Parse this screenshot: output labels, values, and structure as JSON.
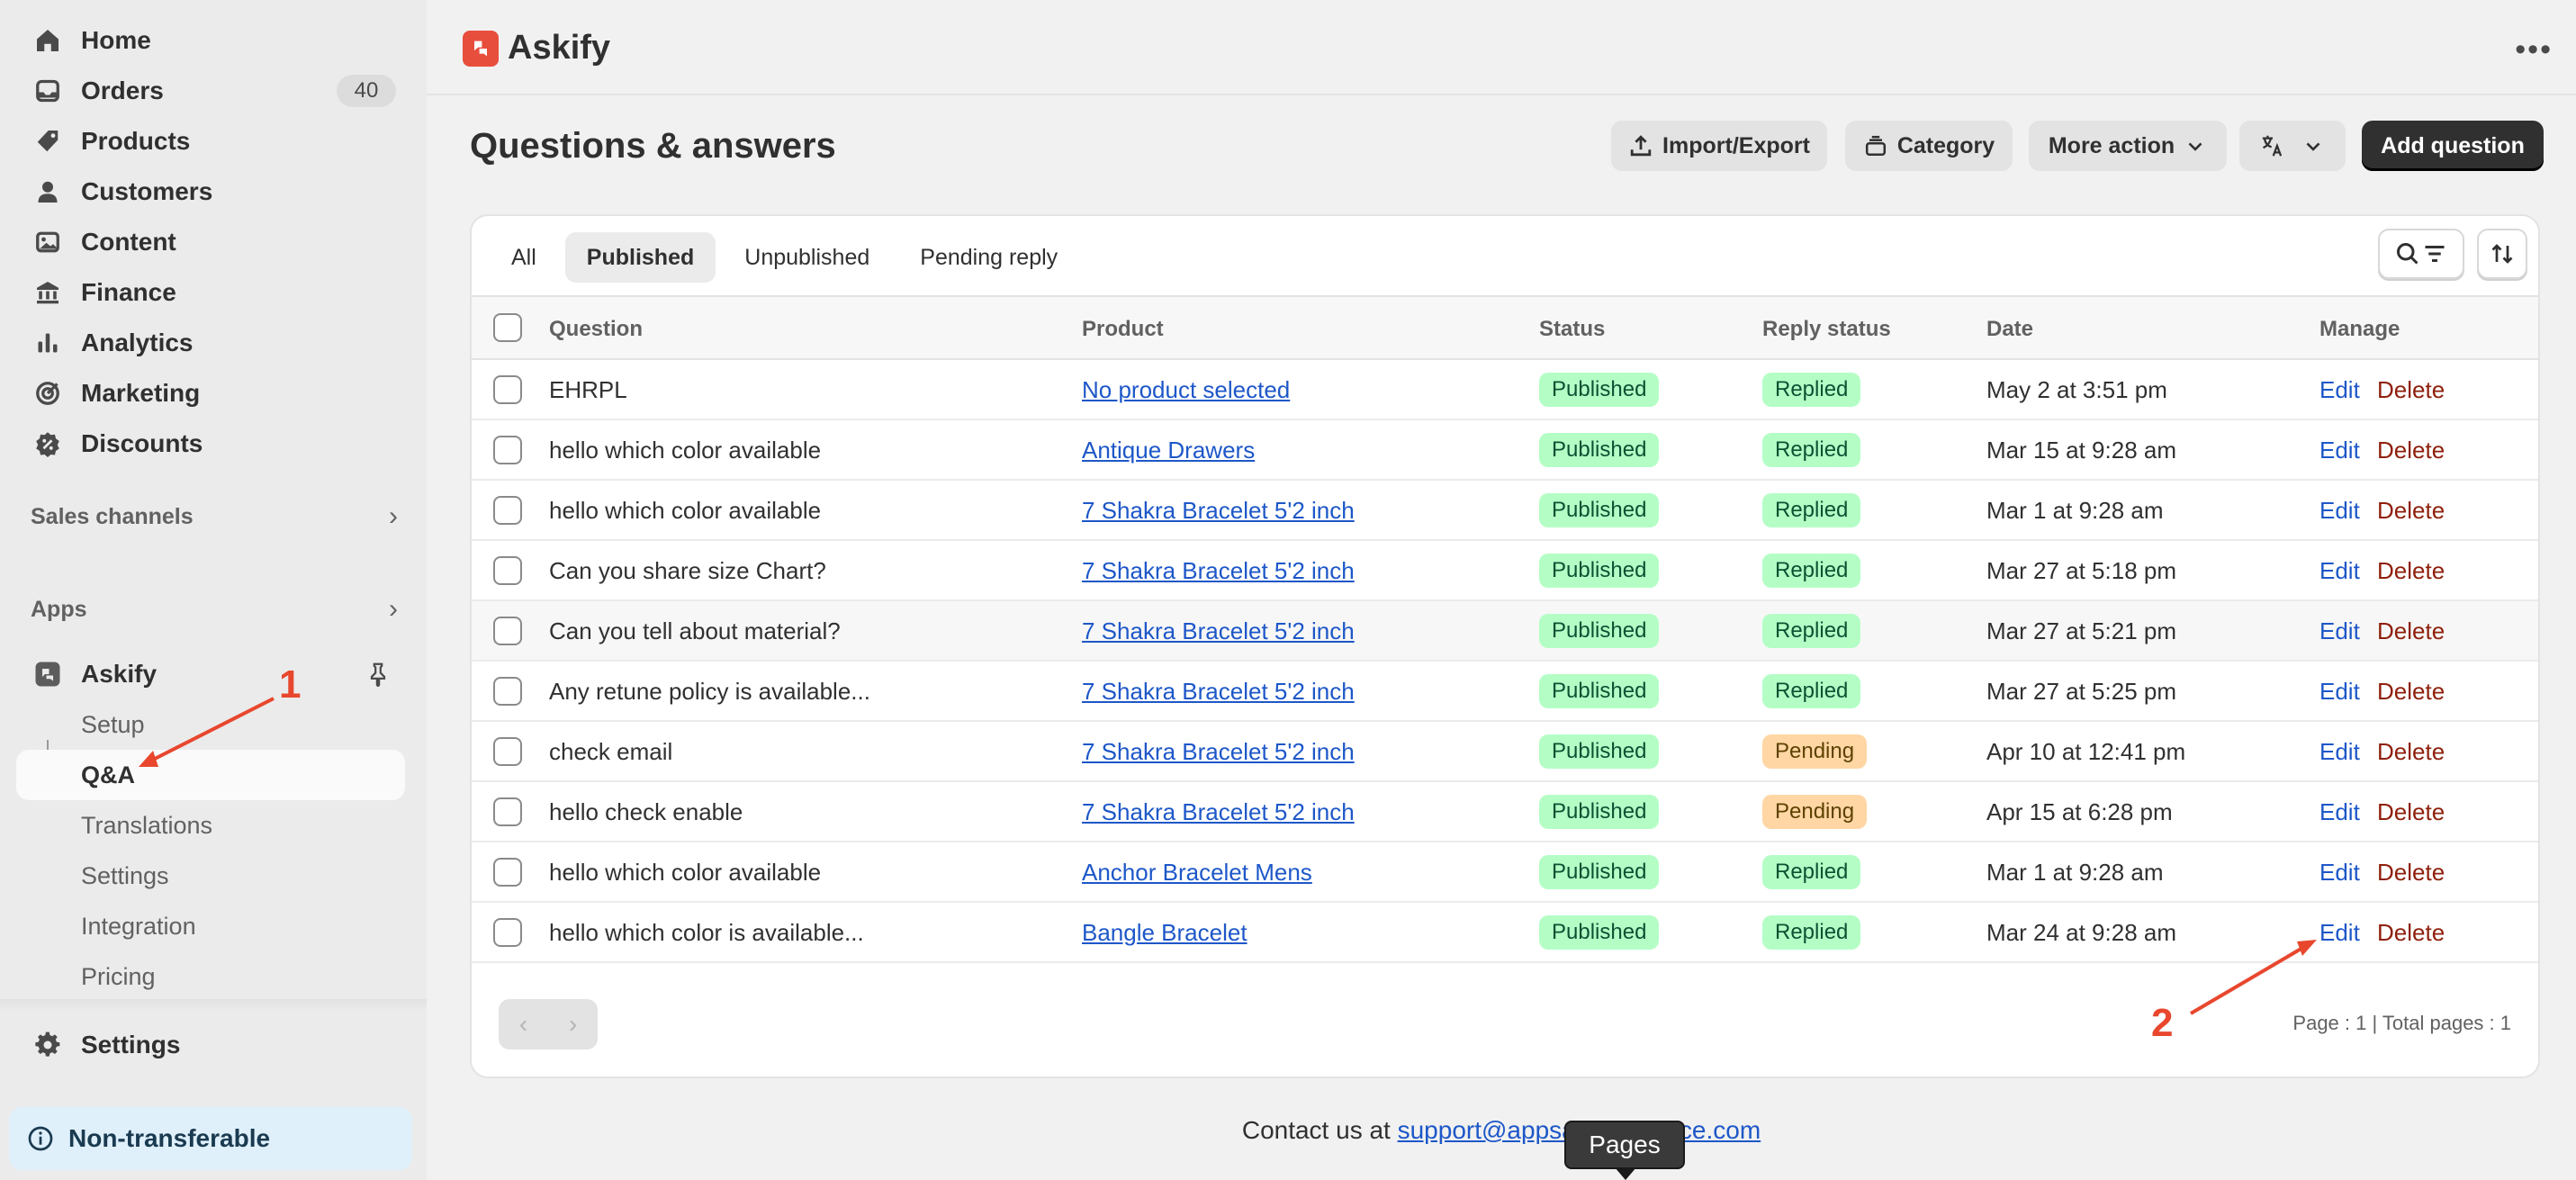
{
  "sidebar": {
    "items": [
      {
        "label": "Home",
        "icon": "home-icon"
      },
      {
        "label": "Orders",
        "icon": "inbox-icon",
        "badge": "40"
      },
      {
        "label": "Products",
        "icon": "tag-icon"
      },
      {
        "label": "Customers",
        "icon": "person-icon"
      },
      {
        "label": "Content",
        "icon": "image-icon"
      },
      {
        "label": "Finance",
        "icon": "bank-icon"
      },
      {
        "label": "Analytics",
        "icon": "bar-chart-icon"
      },
      {
        "label": "Marketing",
        "icon": "target-icon"
      },
      {
        "label": "Discounts",
        "icon": "discount-icon"
      }
    ],
    "sales_channels": "Sales channels",
    "apps": "Apps",
    "app": {
      "label": "Askify",
      "icon": "askify-logo-icon"
    },
    "app_sub": [
      "Setup",
      "Q&A",
      "Translations",
      "Settings",
      "Integration",
      "Pricing"
    ],
    "settings": "Settings",
    "banner": "Non-transferable"
  },
  "header": {
    "app_name": "Askify"
  },
  "page": {
    "title": "Questions & answers",
    "actions": {
      "import_export": "Import/Export",
      "category": "Category",
      "more_action": "More action",
      "add_question": "Add question"
    }
  },
  "tabs": [
    "All",
    "Published",
    "Unpublished",
    "Pending reply"
  ],
  "table": {
    "columns": [
      "Question",
      "Product",
      "Status",
      "Reply status",
      "Date",
      "Manage"
    ],
    "rows": [
      {
        "question": "EHRPL",
        "product": "No product selected",
        "status": "Published",
        "reply": "Replied",
        "date": "May 2 at 3:51 pm"
      },
      {
        "question": "hello which color available",
        "product": "Antique Drawers",
        "status": "Published",
        "reply": "Replied",
        "date": "Mar 15 at 9:28 am"
      },
      {
        "question": "hello which color available",
        "product": "7 Shakra Bracelet 5'2 inch",
        "status": "Published",
        "reply": "Replied",
        "date": "Mar 1 at 9:28 am"
      },
      {
        "question": "Can you share size Chart?",
        "product": "7 Shakra Bracelet 5'2 inch",
        "status": "Published",
        "reply": "Replied",
        "date": "Mar 27 at 5:18 pm"
      },
      {
        "question": "Can you tell about material?",
        "product": "7 Shakra Bracelet 5'2 inch",
        "status": "Published",
        "reply": "Replied",
        "date": "Mar 27 at 5:21 pm"
      },
      {
        "question": "Any retune policy is available...",
        "product": "7 Shakra Bracelet 5'2 inch",
        "status": "Published",
        "reply": "Replied",
        "date": "Mar 27 at 5:25 pm"
      },
      {
        "question": "check email",
        "product": "7 Shakra Bracelet 5'2 inch",
        "status": "Published",
        "reply": "Pending",
        "date": "Apr 10 at 12:41 pm"
      },
      {
        "question": "hello check enable",
        "product": "7 Shakra Bracelet 5'2 inch",
        "status": "Published",
        "reply": "Pending",
        "date": "Apr 15 at 6:28 pm"
      },
      {
        "question": "hello which color available",
        "product": "Anchor Bracelet Mens",
        "status": "Published",
        "reply": "Replied",
        "date": "Mar 1 at 9:28 am"
      },
      {
        "question": "hello which color is available...",
        "product": "Bangle Bracelet",
        "status": "Published",
        "reply": "Replied",
        "date": "Mar 24 at 9:28 am"
      }
    ],
    "edit_label": "Edit",
    "delete_label": "Delete"
  },
  "pagination": {
    "info": "Page : 1 | Total pages : 1",
    "prev": "‹",
    "next": "›"
  },
  "footer": {
    "prefix": "Contact us at ",
    "email": "support@appsacadamence.com"
  },
  "tooltip": "Pages",
  "annotations": [
    "1",
    "2"
  ],
  "colors": {
    "accent_red": "#e8472e",
    "link_blue": "#1d57c8",
    "badge_green": "#b4fec6",
    "badge_orange": "#ffd6a4",
    "brand_askify": "#e84e3c"
  }
}
